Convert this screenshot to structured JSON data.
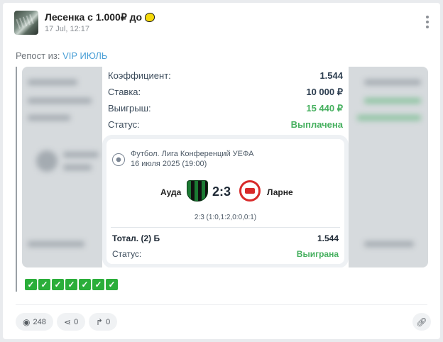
{
  "post": {
    "channel_name": "Лесенка с 1.000₽ до",
    "time": "17 Jul, 12:17",
    "repost_prefix": "Репост из:",
    "repost_source": "VIP ИЮЛЬ"
  },
  "ticket": {
    "coef_label": "Коэффициент:",
    "coef_value": "1.544",
    "stake_label": "Ставка:",
    "stake_value": "10 000 ₽",
    "win_label": "Выигрыш:",
    "win_value": "15 440 ₽",
    "status_label": "Статус:",
    "status_value": "Выплачена",
    "match": {
      "league": "Футбол. Лига Конференций УЕФА",
      "date": "16 июля 2025 (19:00)",
      "home": "Ауда",
      "away": "Ларне",
      "score": "2:3",
      "periods": "2:3 (1:0,1:2,0:0,0:1)",
      "market": "Тотал. (2) Б",
      "market_coef": "1.544",
      "status_label": "Статус:",
      "status_value": "Выиграна"
    }
  },
  "checkmarks": [
    "✓",
    "✓",
    "✓",
    "✓",
    "✓",
    "✓",
    "✓"
  ],
  "stats": {
    "views": "248",
    "shares": "0",
    "reposts": "0"
  },
  "colors": {
    "accent_link": "#4a9fd6",
    "win_green": "#46b05f",
    "check_green": "#2bae3a"
  }
}
